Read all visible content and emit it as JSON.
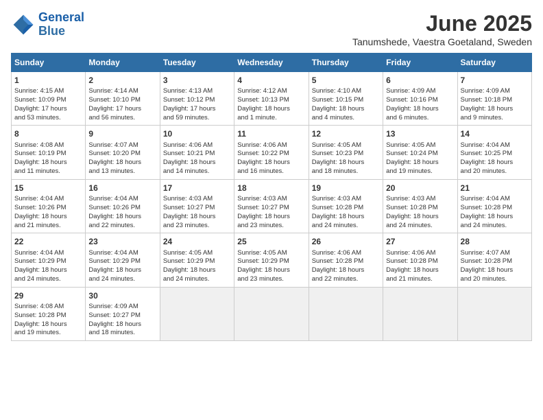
{
  "logo": {
    "line1": "General",
    "line2": "Blue"
  },
  "title": "June 2025",
  "location": "Tanumshede, Vaestra Goetaland, Sweden",
  "weekdays": [
    "Sunday",
    "Monday",
    "Tuesday",
    "Wednesday",
    "Thursday",
    "Friday",
    "Saturday"
  ],
  "weeks": [
    [
      {
        "day": 1,
        "info": "Sunrise: 4:15 AM\nSunset: 10:09 PM\nDaylight: 17 hours\nand 53 minutes."
      },
      {
        "day": 2,
        "info": "Sunrise: 4:14 AM\nSunset: 10:10 PM\nDaylight: 17 hours\nand 56 minutes."
      },
      {
        "day": 3,
        "info": "Sunrise: 4:13 AM\nSunset: 10:12 PM\nDaylight: 17 hours\nand 59 minutes."
      },
      {
        "day": 4,
        "info": "Sunrise: 4:12 AM\nSunset: 10:13 PM\nDaylight: 18 hours\nand 1 minute."
      },
      {
        "day": 5,
        "info": "Sunrise: 4:10 AM\nSunset: 10:15 PM\nDaylight: 18 hours\nand 4 minutes."
      },
      {
        "day": 6,
        "info": "Sunrise: 4:09 AM\nSunset: 10:16 PM\nDaylight: 18 hours\nand 6 minutes."
      },
      {
        "day": 7,
        "info": "Sunrise: 4:09 AM\nSunset: 10:18 PM\nDaylight: 18 hours\nand 9 minutes."
      }
    ],
    [
      {
        "day": 8,
        "info": "Sunrise: 4:08 AM\nSunset: 10:19 PM\nDaylight: 18 hours\nand 11 minutes."
      },
      {
        "day": 9,
        "info": "Sunrise: 4:07 AM\nSunset: 10:20 PM\nDaylight: 18 hours\nand 13 minutes."
      },
      {
        "day": 10,
        "info": "Sunrise: 4:06 AM\nSunset: 10:21 PM\nDaylight: 18 hours\nand 14 minutes."
      },
      {
        "day": 11,
        "info": "Sunrise: 4:06 AM\nSunset: 10:22 PM\nDaylight: 18 hours\nand 16 minutes."
      },
      {
        "day": 12,
        "info": "Sunrise: 4:05 AM\nSunset: 10:23 PM\nDaylight: 18 hours\nand 18 minutes."
      },
      {
        "day": 13,
        "info": "Sunrise: 4:05 AM\nSunset: 10:24 PM\nDaylight: 18 hours\nand 19 minutes."
      },
      {
        "day": 14,
        "info": "Sunrise: 4:04 AM\nSunset: 10:25 PM\nDaylight: 18 hours\nand 20 minutes."
      }
    ],
    [
      {
        "day": 15,
        "info": "Sunrise: 4:04 AM\nSunset: 10:26 PM\nDaylight: 18 hours\nand 21 minutes."
      },
      {
        "day": 16,
        "info": "Sunrise: 4:04 AM\nSunset: 10:26 PM\nDaylight: 18 hours\nand 22 minutes."
      },
      {
        "day": 17,
        "info": "Sunrise: 4:03 AM\nSunset: 10:27 PM\nDaylight: 18 hours\nand 23 minutes."
      },
      {
        "day": 18,
        "info": "Sunrise: 4:03 AM\nSunset: 10:27 PM\nDaylight: 18 hours\nand 23 minutes."
      },
      {
        "day": 19,
        "info": "Sunrise: 4:03 AM\nSunset: 10:28 PM\nDaylight: 18 hours\nand 24 minutes."
      },
      {
        "day": 20,
        "info": "Sunrise: 4:03 AM\nSunset: 10:28 PM\nDaylight: 18 hours\nand 24 minutes."
      },
      {
        "day": 21,
        "info": "Sunrise: 4:04 AM\nSunset: 10:28 PM\nDaylight: 18 hours\nand 24 minutes."
      }
    ],
    [
      {
        "day": 22,
        "info": "Sunrise: 4:04 AM\nSunset: 10:29 PM\nDaylight: 18 hours\nand 24 minutes."
      },
      {
        "day": 23,
        "info": "Sunrise: 4:04 AM\nSunset: 10:29 PM\nDaylight: 18 hours\nand 24 minutes."
      },
      {
        "day": 24,
        "info": "Sunrise: 4:05 AM\nSunset: 10:29 PM\nDaylight: 18 hours\nand 24 minutes."
      },
      {
        "day": 25,
        "info": "Sunrise: 4:05 AM\nSunset: 10:29 PM\nDaylight: 18 hours\nand 23 minutes."
      },
      {
        "day": 26,
        "info": "Sunrise: 4:06 AM\nSunset: 10:28 PM\nDaylight: 18 hours\nand 22 minutes."
      },
      {
        "day": 27,
        "info": "Sunrise: 4:06 AM\nSunset: 10:28 PM\nDaylight: 18 hours\nand 21 minutes."
      },
      {
        "day": 28,
        "info": "Sunrise: 4:07 AM\nSunset: 10:28 PM\nDaylight: 18 hours\nand 20 minutes."
      }
    ],
    [
      {
        "day": 29,
        "info": "Sunrise: 4:08 AM\nSunset: 10:28 PM\nDaylight: 18 hours\nand 19 minutes."
      },
      {
        "day": 30,
        "info": "Sunrise: 4:09 AM\nSunset: 10:27 PM\nDaylight: 18 hours\nand 18 minutes."
      },
      {
        "day": null,
        "info": ""
      },
      {
        "day": null,
        "info": ""
      },
      {
        "day": null,
        "info": ""
      },
      {
        "day": null,
        "info": ""
      },
      {
        "day": null,
        "info": ""
      }
    ]
  ]
}
